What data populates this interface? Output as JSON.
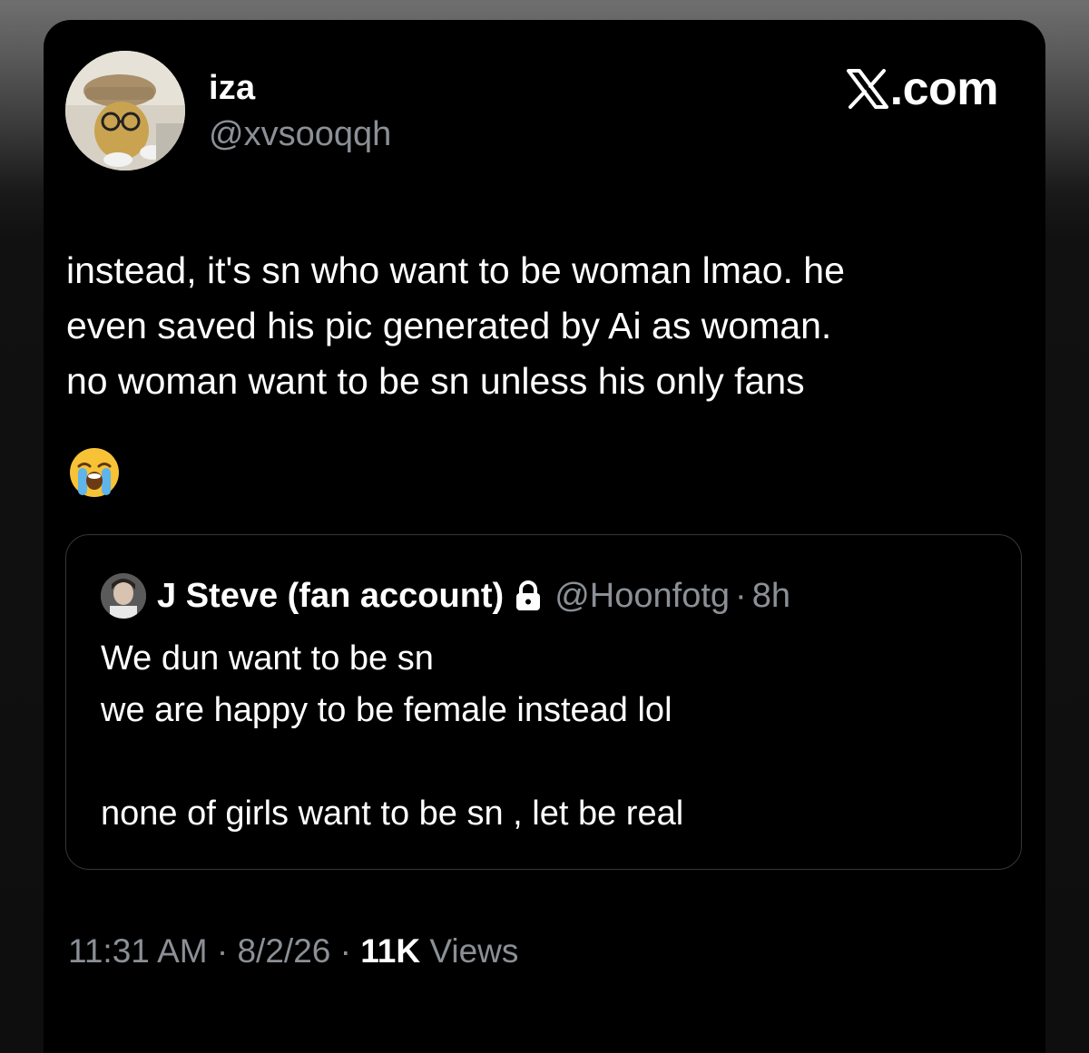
{
  "author": {
    "display_name": "iza",
    "handle": "@xvsooqqh"
  },
  "brand": {
    "label": ".com",
    "icon": "x-logo-icon"
  },
  "tweet": {
    "lines": [
      "instead, it's sn who want to be woman lmao. he",
      "even saved his pic generated by Ai as woman.",
      "no woman want to be sn unless his only fans"
    ],
    "emoji": "loudly-crying-face"
  },
  "quoted": {
    "display_name": "J Steve (fan account)",
    "protected_icon": "lock-icon",
    "handle": "@Hoonfotg",
    "separator": "·",
    "time": "8h",
    "lines": [
      "We dun want to be sn",
      "we are happy to be female instead lol",
      "none of girls want to be sn , let be real"
    ]
  },
  "meta": {
    "time": "11:31 AM",
    "date": "8/2/26",
    "separator": " · ",
    "views_count": "11K",
    "views_label": " Views"
  },
  "colors": {
    "background": "#000000",
    "text": "#ffffff",
    "secondary_text": "#8b9096",
    "border": "#33373b"
  }
}
